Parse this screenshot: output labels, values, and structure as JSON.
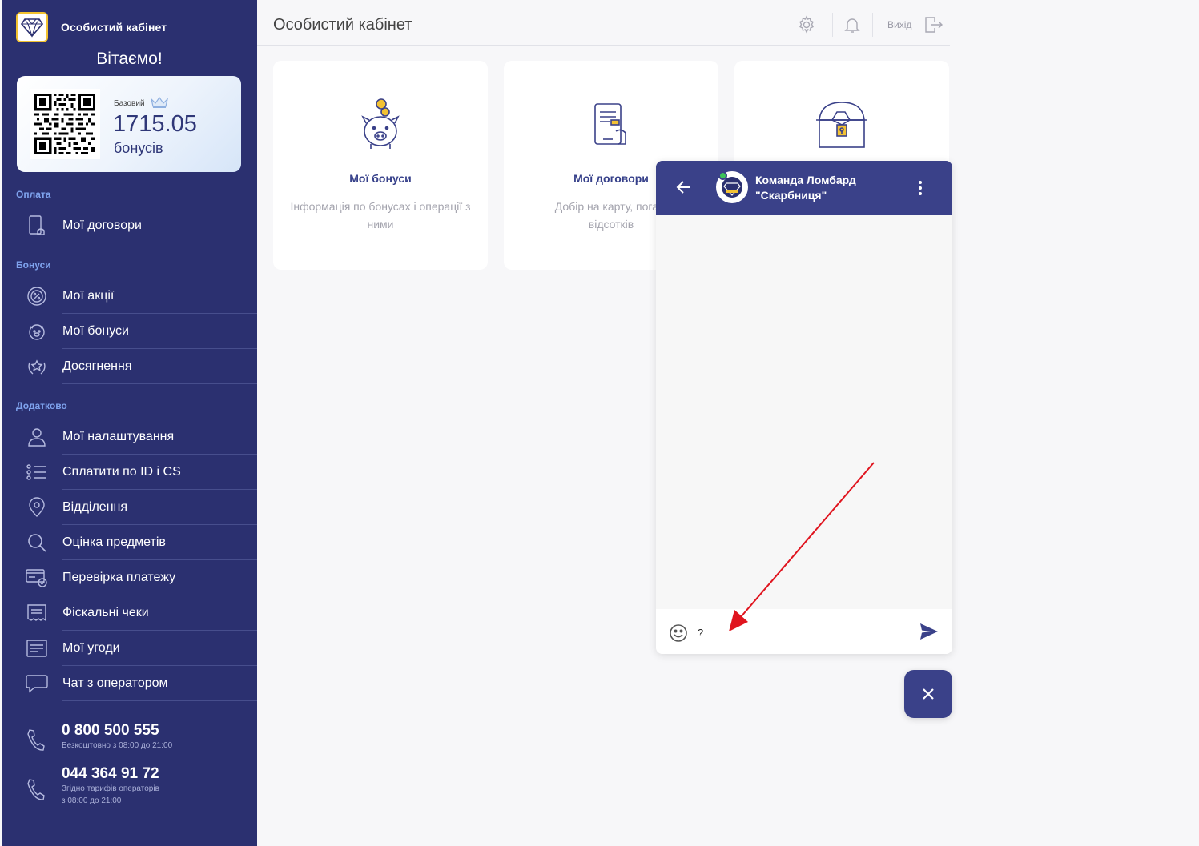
{
  "sidebar": {
    "brand_title": "Особистий кабінет",
    "welcome": "Вітаємо!",
    "bonus_card": {
      "tier": "Базовий",
      "value": "1715.05",
      "unit": "бонусів"
    },
    "sections": {
      "payment": "Оплата",
      "bonuses": "Бонуси",
      "extra": "Додатково"
    },
    "items": {
      "contracts": "Мої договори",
      "promotions": "Мої акції",
      "bonuses": "Мої бонуси",
      "achievements": "Досягнення",
      "settings": "Мої налаштування",
      "pay_by_id": "Сплатити по ID і CS",
      "branches": "Відділення",
      "valuation": "Оцінка предметів",
      "payment_check": "Перевірка платежу",
      "receipts": "Фіскальні чеки",
      "deals": "Мої угоди",
      "chat": "Чат з оператором"
    },
    "phones": [
      {
        "number": "0 800 500 555",
        "note": "Безкоштовно з 08:00 до 21:00"
      },
      {
        "number": "044 364 91 72",
        "note_line1": "Згідно тарифів операторів",
        "note_line2": "з 08:00 до 21:00"
      }
    ]
  },
  "header": {
    "title": "Особистий кабінет",
    "logout": "Вихід"
  },
  "cards": [
    {
      "title": "Мої бонуси",
      "desc": "Інформація по бонусах і операції з ними"
    },
    {
      "title": "Мої договори",
      "desc": "Добір на карту, погаш... відсотків",
      "desc_line1": "Добір на карту, погаш",
      "desc_line2": "відсотків"
    }
  ],
  "chat": {
    "name_line1": "Команда Ломбард",
    "name_line2": "\"Скарбниця\"",
    "input_value": "?"
  },
  "colors": {
    "sidebar": "#2b3070",
    "accent": "#3a4189",
    "section_label": "#7fa3ee",
    "card_title": "#36408a",
    "annotation_arrow": "#e0141e"
  }
}
